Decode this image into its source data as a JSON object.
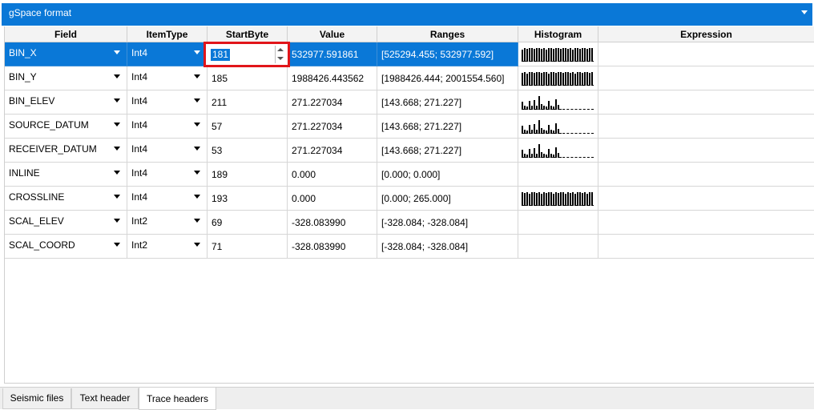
{
  "format": {
    "label": "gSpace format"
  },
  "table": {
    "columns": [
      "Field",
      "ItemType",
      "StartByte",
      "Value",
      "Ranges",
      "Histogram",
      "Expression"
    ],
    "rows": [
      {
        "field": "BIN_X",
        "type": "Int4",
        "start": "181",
        "value": "532977.591861",
        "range": "[525294.455; 532977.592]",
        "hist": [
          12,
          14,
          13,
          14,
          14,
          13,
          14,
          14,
          13,
          14,
          12,
          14,
          14,
          13,
          14,
          14,
          13,
          14,
          14,
          13,
          14,
          12,
          14,
          14,
          13,
          14,
          14,
          13,
          14,
          14
        ]
      },
      {
        "field": "BIN_Y",
        "type": "Int4",
        "start": "185",
        "value": "1988426.443562",
        "range": "[1988426.444; 2001554.560]",
        "hist": [
          13,
          14,
          12,
          14,
          14,
          13,
          14,
          14,
          13,
          14,
          14,
          12,
          14,
          14,
          13,
          14,
          14,
          13,
          14,
          14,
          13,
          14,
          12,
          14,
          14,
          13,
          14,
          14,
          13,
          14
        ]
      },
      {
        "field": "BIN_ELEV",
        "type": "Int4",
        "start": "211",
        "value": "271.227034",
        "range": "[143.668; 271.227]",
        "hist": [
          8,
          4,
          3,
          9,
          4,
          10,
          4,
          14,
          6,
          4,
          3,
          9,
          4,
          3,
          11,
          5,
          1,
          0,
          0,
          0,
          0,
          0,
          0,
          0,
          0,
          0,
          0,
          0,
          0,
          0
        ]
      },
      {
        "field": "SOURCE_DATUM",
        "type": "Int4",
        "start": "57",
        "value": "271.227034",
        "range": "[143.668; 271.227]",
        "hist": [
          8,
          4,
          3,
          9,
          4,
          10,
          4,
          14,
          6,
          4,
          3,
          9,
          4,
          3,
          11,
          5,
          1,
          0,
          0,
          0,
          0,
          0,
          0,
          0,
          0,
          0,
          0,
          0,
          0,
          0
        ]
      },
      {
        "field": "RECEIVER_DATUM",
        "type": "Int4",
        "start": "53",
        "value": "271.227034",
        "range": "[143.668; 271.227]",
        "hist": [
          8,
          4,
          3,
          9,
          4,
          10,
          4,
          14,
          6,
          4,
          3,
          9,
          4,
          3,
          11,
          5,
          1,
          0,
          0,
          0,
          0,
          0,
          0,
          0,
          0,
          0,
          0,
          0,
          0,
          0
        ]
      },
      {
        "field": "INLINE",
        "type": "Int4",
        "start": "189",
        "value": "0.000",
        "range": "[0.000; 0.000]",
        "hist": []
      },
      {
        "field": "CROSSLINE",
        "type": "Int4",
        "start": "193",
        "value": "0.000",
        "range": "[0.000; 265.000]",
        "hist": [
          14,
          13,
          14,
          12,
          14,
          14,
          13,
          14,
          12,
          14,
          13,
          14,
          14,
          12,
          14,
          13,
          14,
          14,
          12,
          14,
          13,
          14,
          12,
          14,
          14,
          13,
          14,
          12,
          14,
          14
        ]
      },
      {
        "field": "SCAL_ELEV",
        "type": "Int2",
        "start": "69",
        "value": "-328.083990",
        "range": "[-328.084; -328.084]",
        "hist": []
      },
      {
        "field": "SCAL_COORD",
        "type": "Int2",
        "start": "71",
        "value": "-328.083990",
        "range": "[-328.084; -328.084]",
        "hist": []
      }
    ]
  },
  "tabs": [
    "Seismic files",
    "Text header",
    "Trace headers"
  ],
  "colors": {
    "accent": "#0a78d7",
    "highlight_border": "#e1151a"
  }
}
